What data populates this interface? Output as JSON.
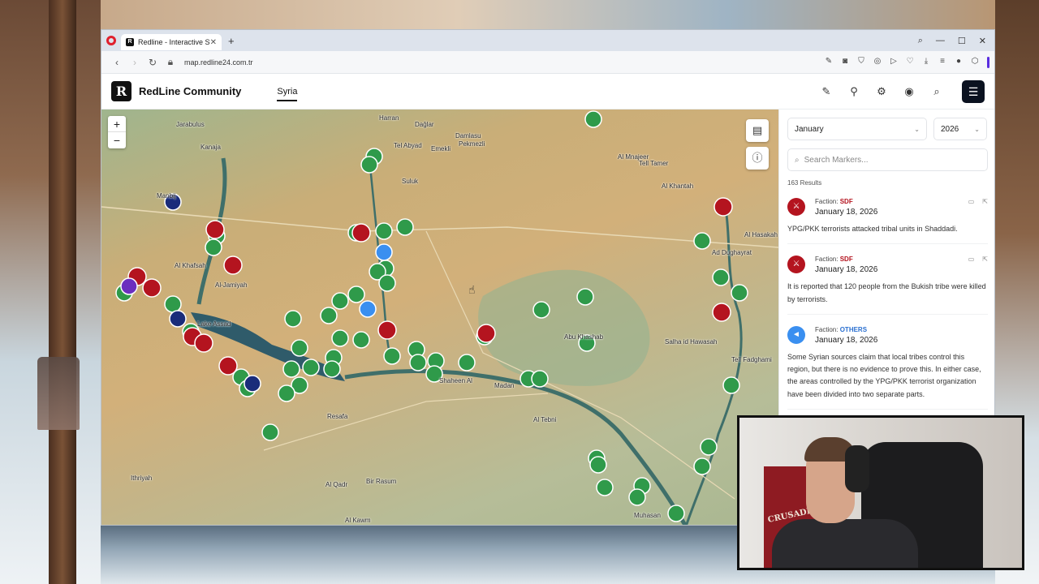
{
  "browser": {
    "tab_title": "Redline - Interactive Strate",
    "tab_favicon": "R",
    "new_tab": "+",
    "url": "map.redline24.com.tr"
  },
  "app": {
    "logo_letter": "R",
    "brand": "RedLine Community",
    "region_tab": "Syria"
  },
  "map": {
    "zoom_in": "+",
    "zoom_out": "−",
    "places": [
      "Jarabulus",
      "Kanaja",
      "Manbij",
      "Al Khafsah",
      "Al-Jamiyah",
      "Lake Assad",
      "Harran",
      "Tel Abyad",
      "Dağlar",
      "Damlasu",
      "Pekmezli",
      "Emekli",
      "Suluk",
      "Tell Tamer",
      "Al Mnajeer",
      "Al Khantah",
      "Al Hasakah",
      "Ad Dughayrat",
      "Shaheen Al",
      "Madan",
      "Abu Khashab",
      "Salha id Hawasah",
      "Tell Fadghami",
      "Al Tebni",
      "Resafa",
      "Al Qadr",
      "Bir Rasum",
      "Ithriyah",
      "Al Kawm",
      "Muhasan"
    ],
    "colors": {
      "green": "#2f9a4a",
      "red": "#b4141f",
      "blue": "#3a8ff0",
      "navy": "#1a2c7a",
      "purple": "#6b2fbf"
    }
  },
  "sidebar": {
    "month": "January",
    "year": "2026",
    "search_placeholder": "Search Markers...",
    "results": "163 Results",
    "items": [
      {
        "faction_label": "Faction:",
        "faction": "SDF",
        "date": "January 18, 2026",
        "desc": "YPG/PKK terrorists attacked tribal units in Shaddadi."
      },
      {
        "faction_label": "Faction:",
        "faction": "SDF",
        "date": "January 18, 2026",
        "desc": "It is reported that 120 people from the Bukish tribe were killed by terrorists."
      },
      {
        "faction_label": "Faction:",
        "faction": "OTHERS",
        "date": "January 18, 2026",
        "desc": "Some Syrian sources claim that local tribes control this region, but there is no evidence to prove this. In either case, the areas controlled by the YPG/PKK terrorist organization have been divided into two separate parts."
      }
    ]
  },
  "webcam": {
    "banner": "CRUSADER KINGS"
  }
}
